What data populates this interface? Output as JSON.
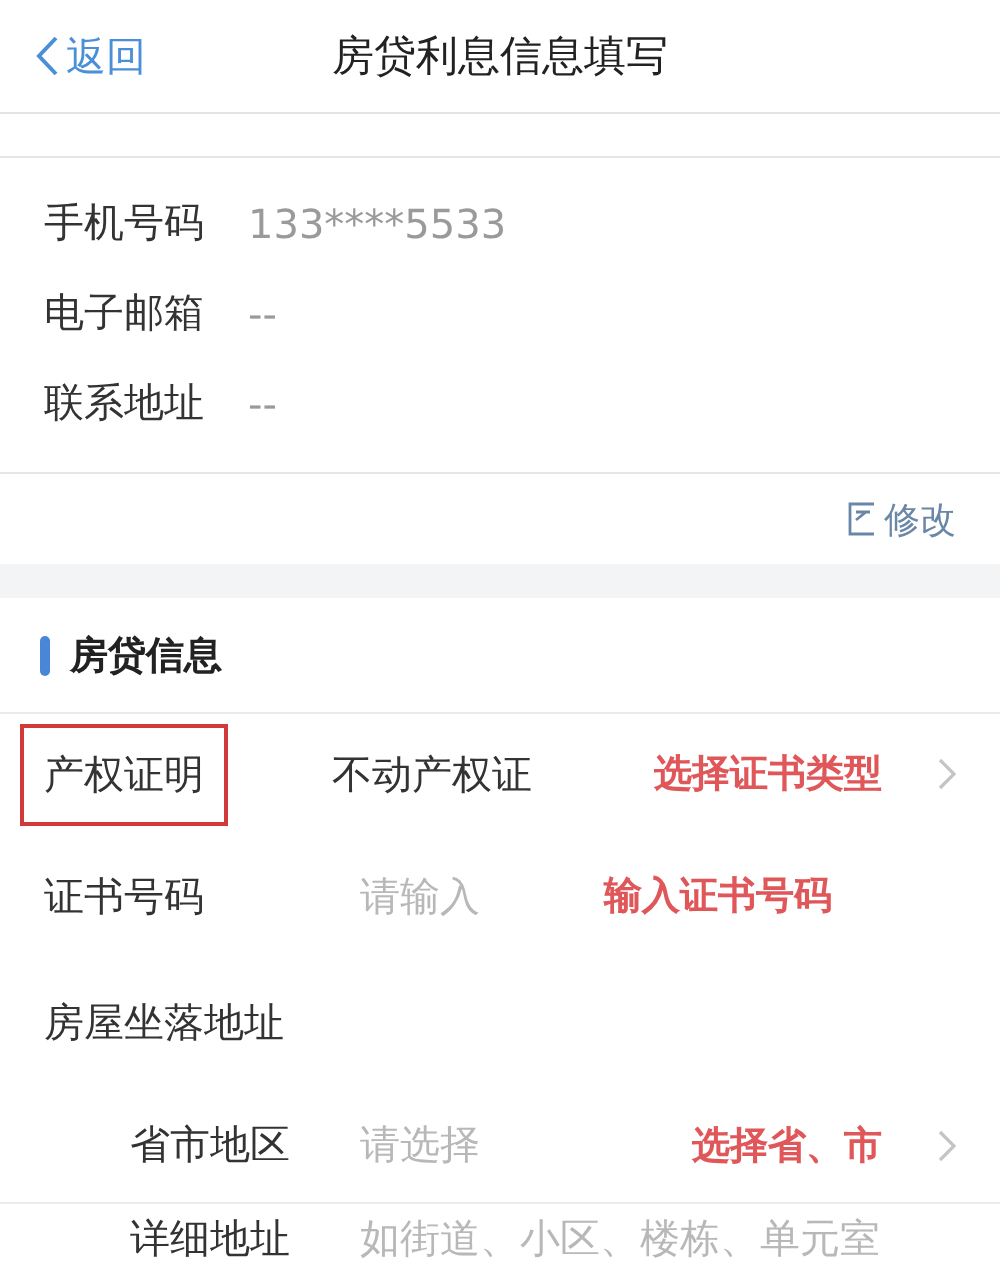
{
  "nav": {
    "back": "返回",
    "title": "房贷利息信息填写"
  },
  "contact": [
    {
      "label": "手机号码",
      "value": "133****5533"
    },
    {
      "label": "电子邮箱",
      "value": "--"
    },
    {
      "label": "联系地址",
      "value": "--"
    }
  ],
  "edit_link": "修改",
  "section": {
    "title": "房贷信息"
  },
  "fields": [
    {
      "kind": "select",
      "label": "产权证明",
      "value": "不动产权证",
      "annotation": "选择证书类型",
      "highlighted": true,
      "indented": false
    },
    {
      "kind": "input",
      "label": "证书号码",
      "placeholder": "请输入",
      "annotation": "输入证书号码",
      "highlighted": false,
      "indented": false
    },
    {
      "kind": "heading",
      "label": "房屋坐落地址",
      "highlighted": false
    },
    {
      "kind": "select",
      "label": "省市地区",
      "placeholder": "请选择",
      "annotation": "选择省、市",
      "highlighted": false,
      "indented": true
    },
    {
      "kind": "input",
      "label": "详细地址",
      "placeholder": "如街道、小区、楼栋、单元室",
      "highlighted": false,
      "indented": true
    }
  ]
}
